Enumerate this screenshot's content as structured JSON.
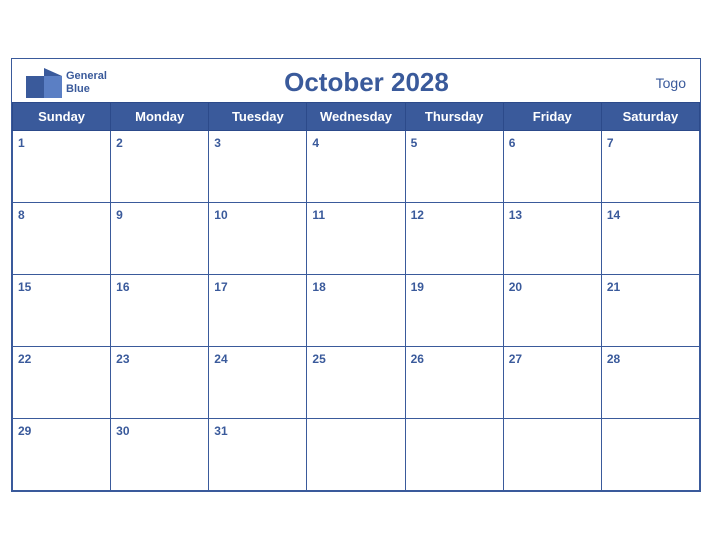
{
  "header": {
    "logo_general": "General",
    "logo_blue": "Blue",
    "month_year": "October 2028",
    "country": "Togo"
  },
  "weekdays": [
    "Sunday",
    "Monday",
    "Tuesday",
    "Wednesday",
    "Thursday",
    "Friday",
    "Saturday"
  ],
  "weeks": [
    [
      1,
      2,
      3,
      4,
      5,
      6,
      7
    ],
    [
      8,
      9,
      10,
      11,
      12,
      13,
      14
    ],
    [
      15,
      16,
      17,
      18,
      19,
      20,
      21
    ],
    [
      22,
      23,
      24,
      25,
      26,
      27,
      28
    ],
    [
      29,
      30,
      31,
      null,
      null,
      null,
      null
    ]
  ]
}
